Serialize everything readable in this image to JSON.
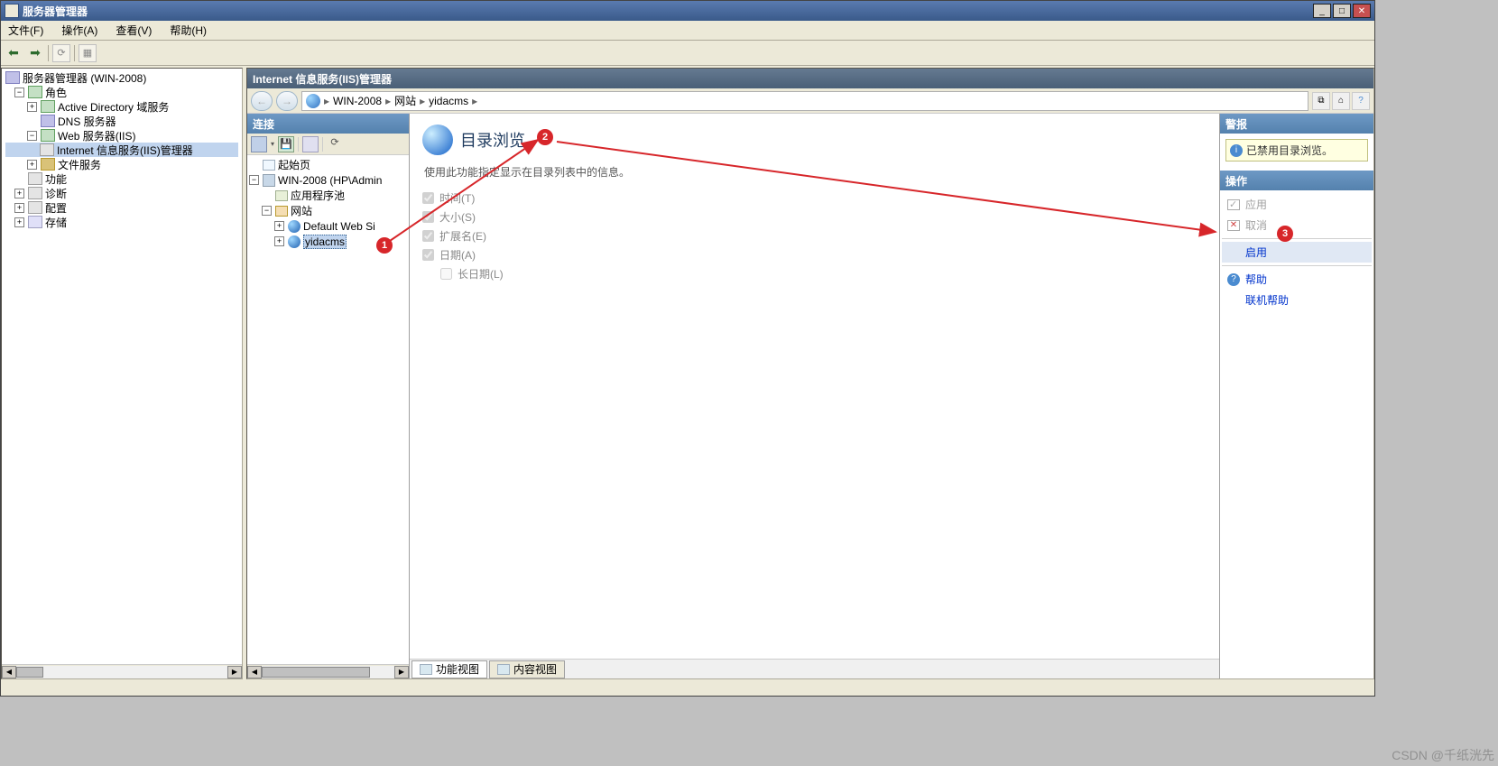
{
  "window": {
    "title": "服务器管理器",
    "menu": {
      "file": "文件(F)",
      "action": "操作(A)",
      "view": "查看(V)",
      "help": "帮助(H)"
    }
  },
  "left_tree": {
    "root": "服务器管理器 (WIN-2008)",
    "nodes": {
      "roles": "角色",
      "ad": "Active Directory 域服务",
      "dns": "DNS 服务器",
      "web": "Web 服务器(IIS)",
      "iismgr": "Internet 信息服务(IIS)管理器",
      "filesvc": "文件服务",
      "features": "功能",
      "diag": "诊断",
      "config": "配置",
      "storage": "存储"
    }
  },
  "iis": {
    "title": "Internet 信息服务(IIS)管理器",
    "breadcrumb": [
      "WIN-2008",
      "网站",
      "yidacms"
    ],
    "connections": {
      "header": "连接",
      "start_page": "起始页",
      "server": "WIN-2008 (HP\\Admin",
      "app_pool": "应用程序池",
      "sites": "网站",
      "default_site": "Default Web Si",
      "target_site": "yidacms"
    },
    "feature": {
      "title": "目录浏览",
      "desc": "使用此功能指定显示在目录列表中的信息。",
      "options": {
        "time": "时间(T)",
        "size": "大小(S)",
        "ext": "扩展名(E)",
        "date": "日期(A)",
        "longdate": "长日期(L)"
      }
    },
    "footer_tabs": {
      "features_view": "功能视图",
      "content_view": "内容视图"
    },
    "actions": {
      "alerts_header": "警报",
      "alert_text": "已禁用目录浏览。",
      "ops_header": "操作",
      "apply": "应用",
      "cancel": "取消",
      "enable": "启用",
      "help": "帮助",
      "online_help": "联机帮助"
    }
  },
  "annotations": {
    "b1": "1",
    "b2": "2",
    "b3": "3"
  },
  "watermark": "CSDN @千纸洸先"
}
